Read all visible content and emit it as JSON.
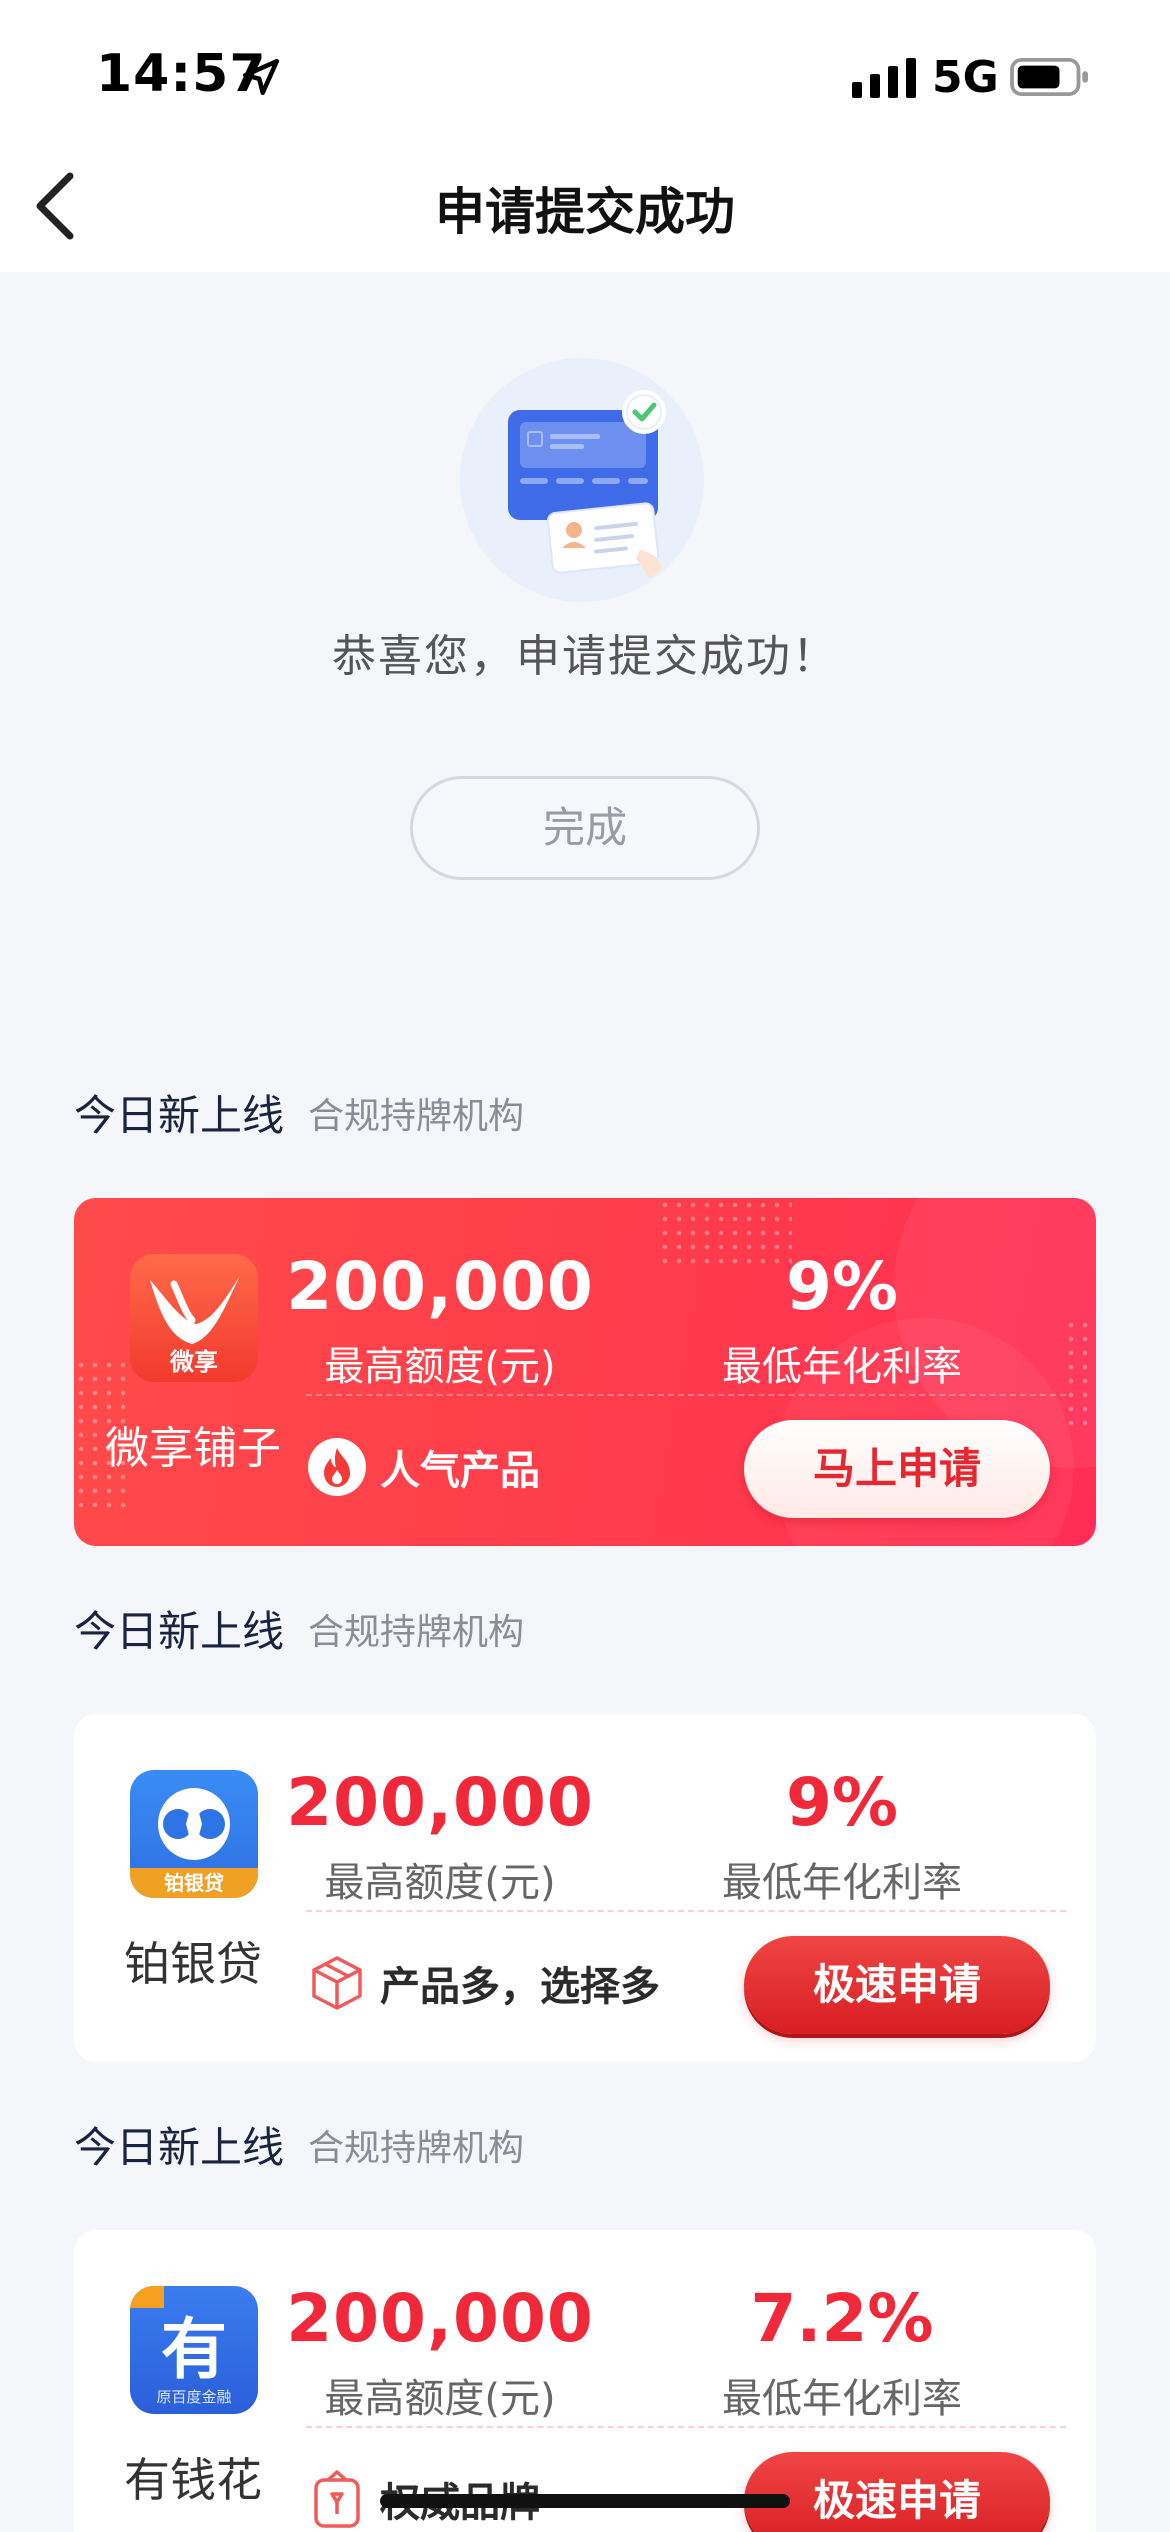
{
  "status_bar": {
    "time": "14:57",
    "network": "5G"
  },
  "nav": {
    "title": "申请提交成功"
  },
  "success": {
    "message": "恭喜您，申请提交成功！",
    "done_button": "完成"
  },
  "sections": [
    {
      "title": "今日新上线",
      "subtitle": "合规持牌机构",
      "card": {
        "brand": "微享铺子",
        "logo_text": "微享",
        "amount": "200,000",
        "amount_label": "最高额度(元)",
        "rate": "9%",
        "rate_label": "最低年化利率",
        "tag": "人气产品",
        "button": "马上申请"
      }
    },
    {
      "title": "今日新上线",
      "subtitle": "合规持牌机构",
      "card": {
        "brand": "铂银贷",
        "logo_text": "铂银贷",
        "amount": "200,000",
        "amount_label": "最高额度(元)",
        "rate": "9%",
        "rate_label": "最低年化利率",
        "tag": "产品多，选择多",
        "button": "极速申请"
      }
    },
    {
      "title": "今日新上线",
      "subtitle": "合规持牌机构",
      "card": {
        "brand": "有钱花",
        "logo_text": "有",
        "logo_caption": "原百度金融",
        "amount": "200,000",
        "amount_label": "最高额度(元)",
        "rate": "7.2%",
        "rate_label": "最低年化利率",
        "tag": "权威品牌",
        "button": "极速申请"
      }
    }
  ],
  "colors": {
    "accent_red": "#f0293a",
    "featured_bg": "#ff3c4b",
    "nav_bg": "#ffffff",
    "page_bg": "#f5f6fa"
  },
  "icons": [
    "location-arrow-icon",
    "signal-icon",
    "battery-icon",
    "back-chevron-icon",
    "fire-icon",
    "box-icon",
    "hand-badge-icon"
  ]
}
